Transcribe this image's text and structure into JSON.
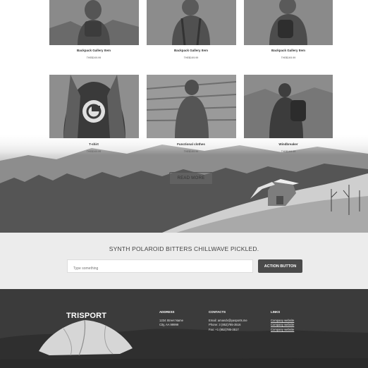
{
  "products": [
    {
      "name": "Backpack Gallery Item",
      "price": "THE$1K9.99"
    },
    {
      "name": "Backpack Gallery Item",
      "price": "THE$1K9.99"
    },
    {
      "name": "Backpack Gallery Item",
      "price": "THE$1K9.99"
    },
    {
      "name": "T-shirt",
      "price": "THE$1K9.99"
    },
    {
      "name": "Functional clothes",
      "price": "THE$1K9.99"
    },
    {
      "name": "Windbreaker",
      "price": "THE$1K9.99"
    }
  ],
  "read_more_label": "READ MORE",
  "cta": {
    "headline": "SYNTH POLAROID BITTERS CHILLWAVE PICKLED.",
    "input_placeholder": "Type something",
    "button_label": "ACTION BUTTON"
  },
  "footer": {
    "logo": "TRISPORT",
    "address": {
      "heading": "ADDRESS",
      "lines": [
        "1234 Street Name",
        "City, AA 99999"
      ]
    },
    "contacts": {
      "heading": "CONTACTS",
      "lines": [
        "Email: amandx@yasports.me",
        "Phone: 3 (852)785-3516",
        "Fax: +1 (852)785-3517"
      ]
    },
    "links": {
      "heading": "LINKS",
      "items": [
        "Company website",
        "Company website",
        "Company website"
      ]
    }
  }
}
